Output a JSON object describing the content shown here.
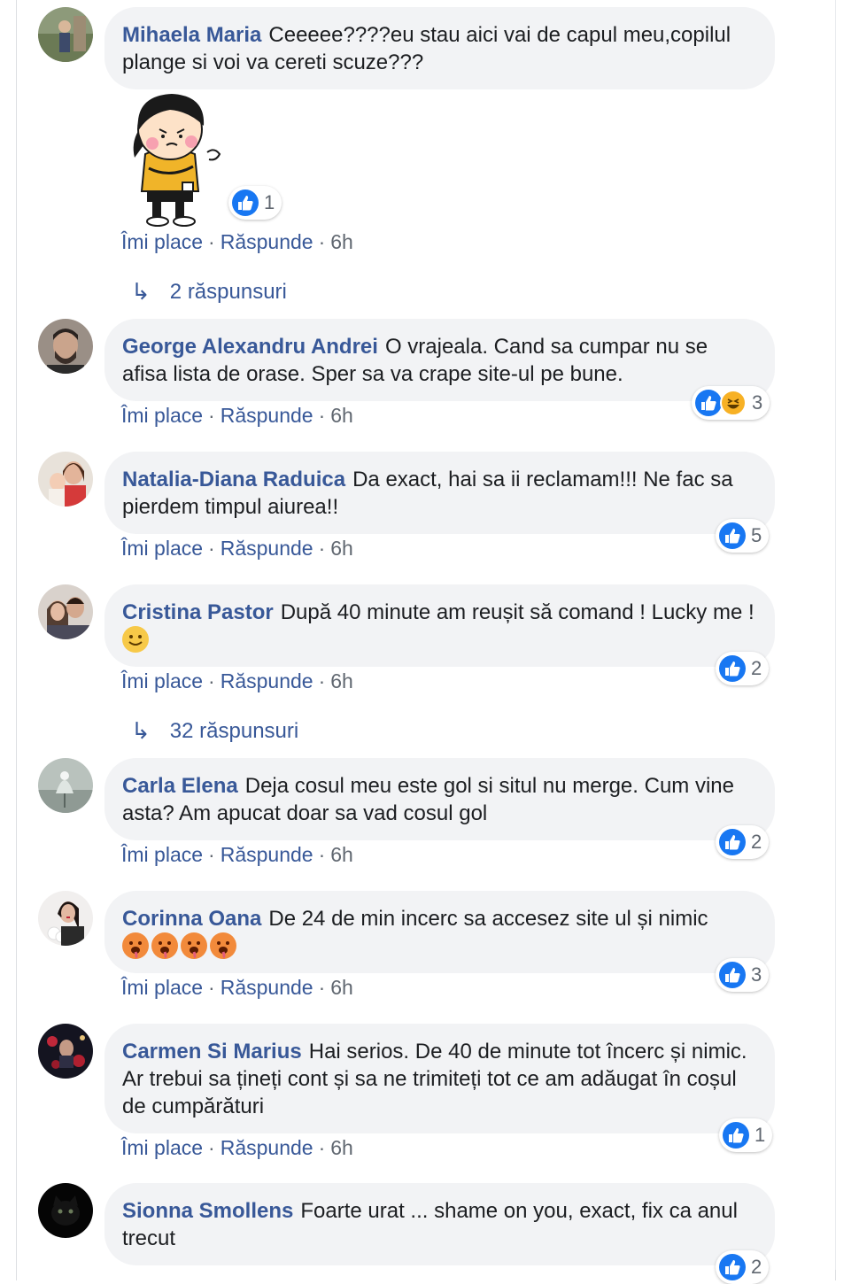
{
  "actions": {
    "like": "Îmi place",
    "reply": "Răspunde",
    "time": "6h",
    "dot": "·"
  },
  "comments": [
    {
      "author": "Mihaela Maria",
      "text": "Ceeeee????eu stau aici vai de capul meu,copilul plange si voi va cereti scuze???",
      "reactions": {
        "count": "1",
        "types": [
          "like-icon"
        ]
      },
      "sticker": "angry-girl-sticker",
      "replies": "2 răspunsuri"
    },
    {
      "author": "George Alexandru Andrei",
      "text": "O vrajeala. Cand sa cumpar nu se afisa lista de orase. Sper sa va crape site-ul pe bune.",
      "reactions": {
        "count": "3",
        "types": [
          "like-icon",
          "haha-icon"
        ]
      }
    },
    {
      "author": "Natalia-Diana Raduica",
      "text": "Da exact, hai sa ii reclamam!!! Ne fac sa pierdem timpul aiurea!!",
      "reactions": {
        "count": "5",
        "types": [
          "like-icon"
        ]
      }
    },
    {
      "author": "Cristina Pastor",
      "text": "După 40 minute am reușit să comand ! Lucky me !",
      "emoji": [
        "smile-emoji"
      ],
      "reactions": {
        "count": "2",
        "types": [
          "like-icon"
        ]
      },
      "replies": "32 răspunsuri"
    },
    {
      "author": "Carla Elena",
      "text": "Deja cosul meu este gol si situl nu merge. Cum vine asta? Am apucat doar sa vad cosul gol",
      "reactions": {
        "count": "2",
        "types": [
          "like-icon"
        ]
      }
    },
    {
      "author": "Corinna Oana",
      "text": "De 24 de min incerc sa accesez site ul și nimic",
      "emoji": [
        "hot-face-emoji",
        "hot-face-emoji",
        "hot-face-emoji",
        "hot-face-emoji"
      ],
      "reactions": {
        "count": "3",
        "types": [
          "like-icon"
        ]
      }
    },
    {
      "author": "Carmen Si Marius",
      "text": "Hai serios. De 40 de minute tot încerc și nimic. Ar trebui sa țineți cont și sa ne trimiteți tot ce am adăugat în coșul de cumpărături",
      "reactions": {
        "count": "1",
        "types": [
          "like-icon"
        ]
      }
    },
    {
      "author": "Sionna Smollens",
      "text": "Foarte urat ... shame on you, exact, fix ca anul trecut",
      "reactions": {
        "count": "2",
        "types": [
          "like-icon"
        ]
      }
    }
  ],
  "colors": {
    "link": "#385898",
    "bubble": "#f2f3f5",
    "like": "#1877f2",
    "meta": "#606770"
  }
}
